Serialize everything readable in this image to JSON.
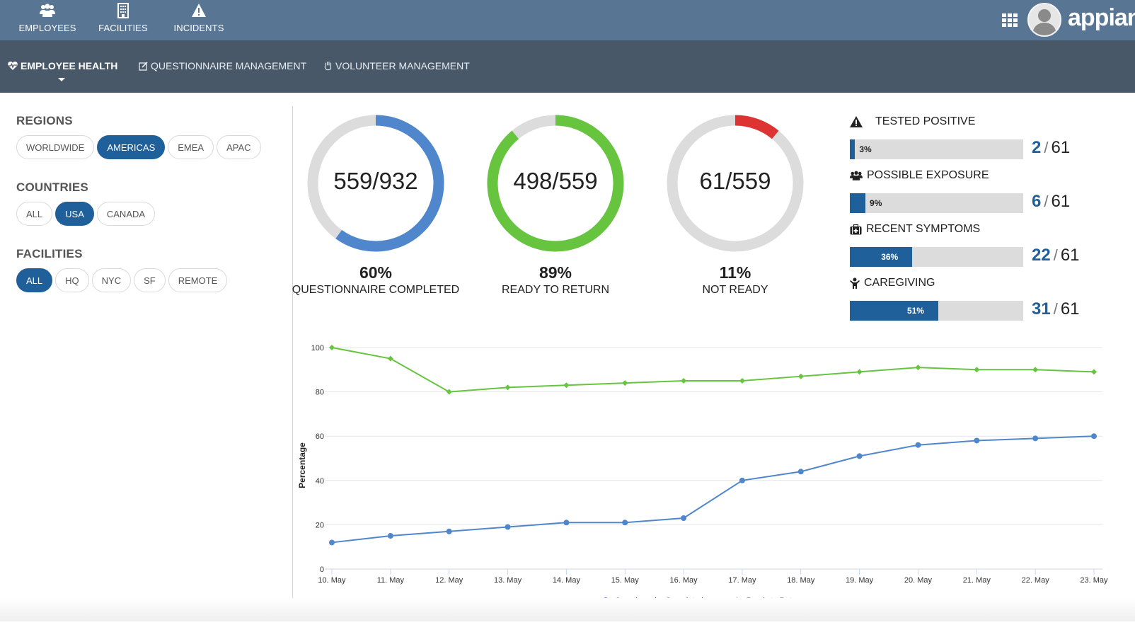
{
  "topnav": {
    "items": [
      {
        "label": "EMPLOYEES",
        "icon": "users-icon"
      },
      {
        "label": "FACILITIES",
        "icon": "building-icon"
      },
      {
        "label": "INCIDENTS",
        "icon": "warning-icon"
      }
    ],
    "apps_icon": "grid-icon",
    "avatar_icon": "user-avatar",
    "logo": "appian"
  },
  "subnav": {
    "items": [
      {
        "label": "EMPLOYEE HEALTH",
        "icon": "heartbeat-icon",
        "active": true
      },
      {
        "label": "QUESTIONNAIRE MANAGEMENT",
        "icon": "edit-icon",
        "active": false
      },
      {
        "label": "VOLUNTEER MANAGEMENT",
        "icon": "hand-icon",
        "active": false
      }
    ]
  },
  "filters": {
    "regions": {
      "title": "REGIONS",
      "options": [
        "WORLDWIDE",
        "AMERICAS",
        "EMEA",
        "APAC"
      ],
      "selected": "AMERICAS"
    },
    "countries": {
      "title": "COUNTRIES",
      "options": [
        "ALL",
        "USA",
        "CANADA"
      ],
      "selected": "USA"
    },
    "facilities": {
      "title": "FACILITIES",
      "options": [
        "ALL",
        "HQ",
        "NYC",
        "SF",
        "REMOTE"
      ],
      "selected": "ALL"
    }
  },
  "donuts": [
    {
      "value_text": "559/932",
      "fraction": 0.6,
      "percent": "60%",
      "caption": "QUESTIONNAIRE COMPLETED",
      "color": "#5086cc"
    },
    {
      "value_text": "498/559",
      "fraction": 0.89,
      "percent": "89%",
      "caption": "READY TO RETURN",
      "color": "#66c43f"
    },
    {
      "value_text": "61/559",
      "fraction": 0.11,
      "percent": "11%",
      "caption": "NOT READY",
      "color": "#dd3333"
    }
  ],
  "stats": [
    {
      "title": "TESTED POSITIVE",
      "icon": "warning-icon",
      "percent": 3,
      "percent_label": "3%",
      "count": "2",
      "total": "61"
    },
    {
      "title": "POSSIBLE EXPOSURE",
      "icon": "users-icon",
      "percent": 9,
      "percent_label": "9%",
      "count": "6",
      "total": "61"
    },
    {
      "title": "RECENT SYMPTOMS",
      "icon": "medkit-icon",
      "percent": 36,
      "percent_label": "36%",
      "count": "22",
      "total": "61"
    },
    {
      "title": "CAREGIVING",
      "icon": "child-icon",
      "percent": 51,
      "percent_label": "51%",
      "count": "31",
      "total": "61"
    }
  ],
  "chart_data": {
    "type": "line",
    "title": "",
    "xlabel": "",
    "ylabel": "Percentage",
    "ylim": [
      0,
      100
    ],
    "yticks": [
      0,
      20,
      40,
      60,
      80,
      100
    ],
    "grid": true,
    "legend": "bottom-center",
    "x": [
      "10. May",
      "11. May",
      "12. May",
      "13. May",
      "14. May",
      "15. May",
      "16. May",
      "17. May",
      "18. May",
      "19. May",
      "20. May",
      "21. May",
      "22. May",
      "23. May"
    ],
    "series": [
      {
        "name": "Questionnaire Completed",
        "color": "#5086cc",
        "marker": "circle",
        "values": [
          12,
          15,
          17,
          19,
          21,
          21,
          23,
          40,
          44,
          51,
          56,
          58,
          59,
          60
        ]
      },
      {
        "name": "Ready to Return",
        "color": "#66c43f",
        "marker": "diamond",
        "values": [
          100,
          95,
          80,
          82,
          83,
          84,
          85,
          85,
          87,
          89,
          91,
          90,
          90,
          89
        ]
      }
    ]
  }
}
